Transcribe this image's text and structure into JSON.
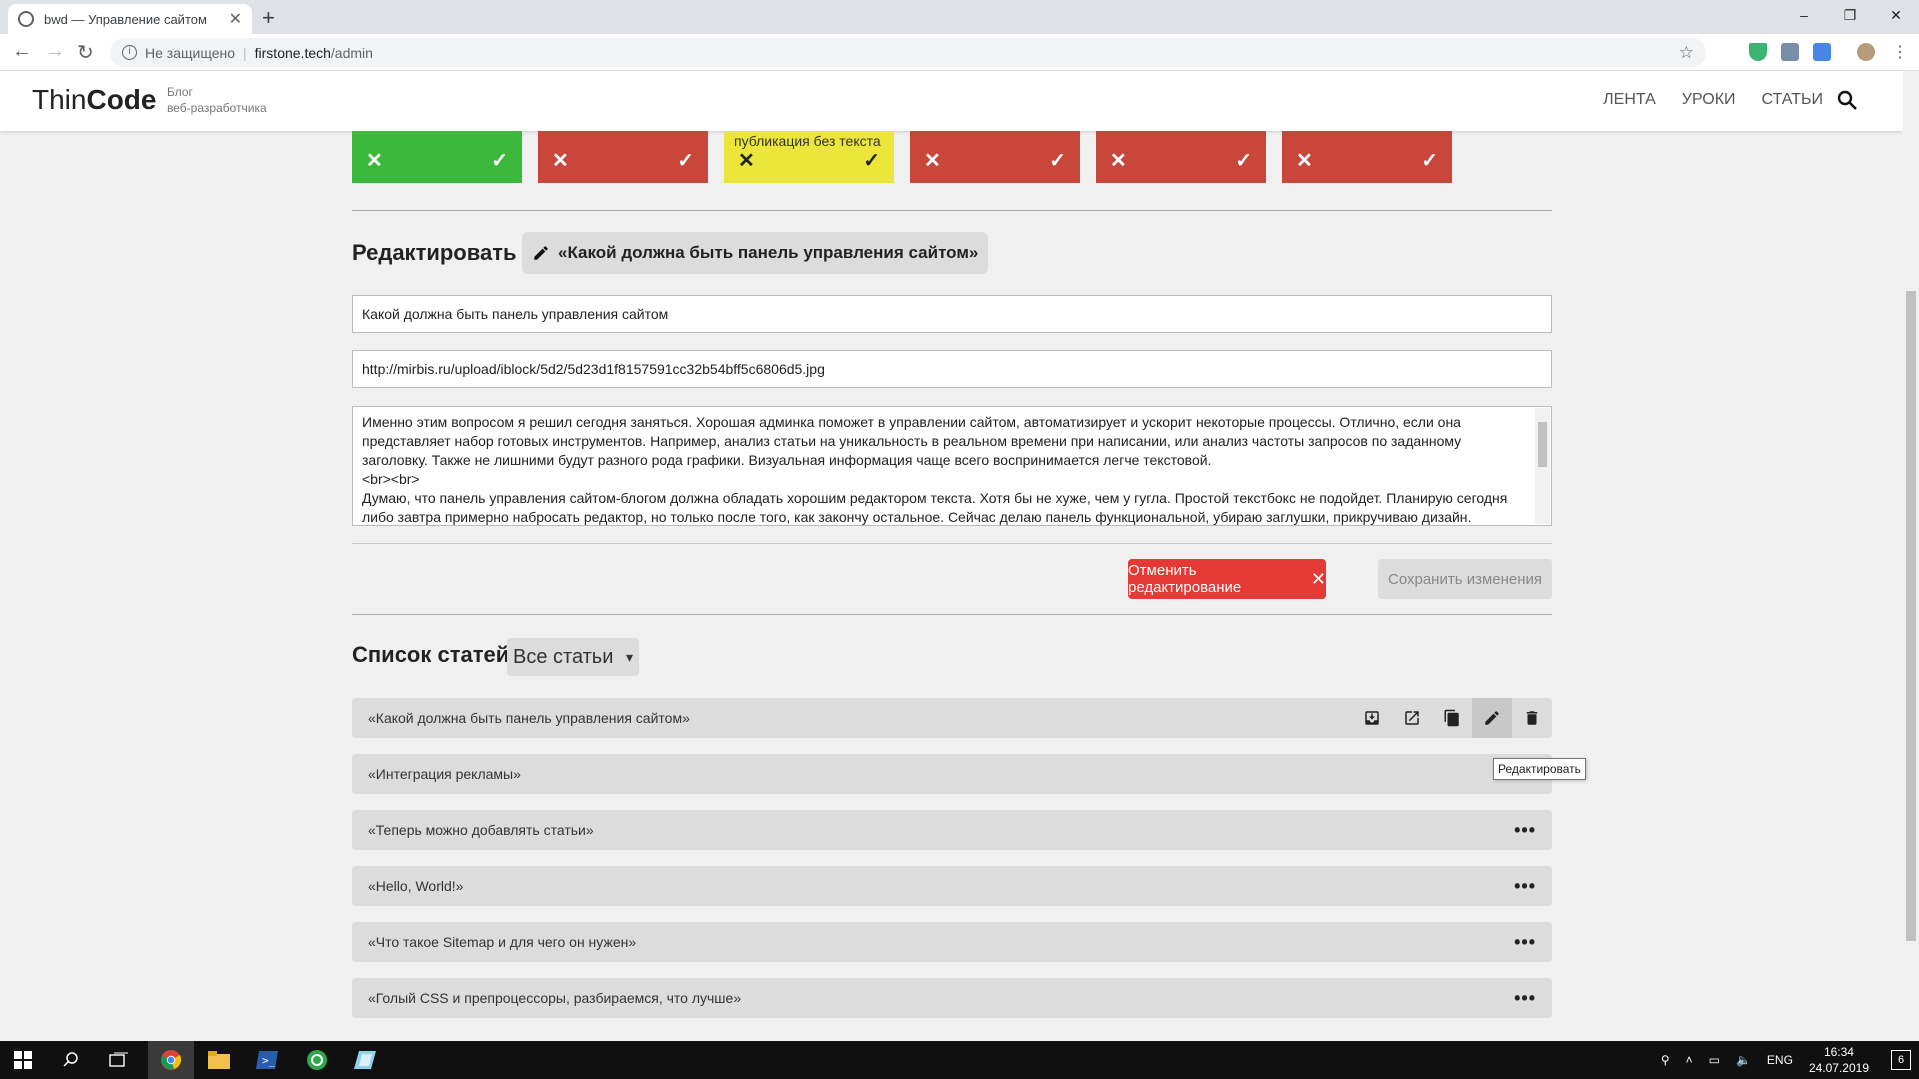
{
  "browser": {
    "tab_title": "bwd — Управление сайтом",
    "tab_close": "✕",
    "new_tab": "+",
    "security_label": "Не защищено",
    "url_host": "firstone.tech",
    "url_path": "/admin",
    "window_controls": [
      "–",
      "❐",
      "✕"
    ]
  },
  "site": {
    "logo_thin": "Thin",
    "logo_code": "Code",
    "tagline_line1": "Блог",
    "tagline_line2": "веб-разработчика",
    "nav": [
      "ЛЕНТА",
      "УРОКИ",
      "СТАТЬИ"
    ]
  },
  "status_blocks": [
    {
      "color": "#3cb93c",
      "note": ""
    },
    {
      "color": "#c9473a",
      "note": ""
    },
    {
      "color": "#ece53a",
      "note": "публикация без текста"
    },
    {
      "color": "#c9473a",
      "note": ""
    },
    {
      "color": "#c9473a",
      "note": ""
    },
    {
      "color": "#c9473a",
      "note": ""
    }
  ],
  "status_symbols": {
    "reject": "✕",
    "approve": "✓"
  },
  "edit": {
    "heading": "Редактировать",
    "chip_label": "«Какой должна быть панель управления сайтом»",
    "title_value": "Какой должна быть панель управления сайтом",
    "image_value": "http://mirbis.ru/upload/iblock/5d2/5d23d1f8157591cc32b54bff5c6806d5.jpg",
    "body_text": "Именно этим вопросом я решил сегодня заняться. Хорошая админка поможет в управлении сайтом, автоматизирует и ускорит некоторые процессы. Отлично, если она представляет набор готовых инструментов. Например, анализ статьи на уникальность в реальном времени при написании, или анализ частоты запросов по заданному заголовку. Также не лишними будут разного рода графики. Визуальная информация чаще всего воспринимается легче текстовой.\n<br><br>\nДумаю, что панель управления сайтом-блогом должна обладать хорошим редактором текста. Хотя бы не хуже, чем у гугла. Простой текстбокс не подойдет. Планирую сегодня либо завтра примерно набросать редактор, но только после того, как закончу остальное. Сейчас делаю панель функциональной, убираю заглушки, прикручиваю дизайн. Удаление",
    "cancel_label": "Отменить редактирование",
    "cancel_icon": "✕",
    "save_label": "Сохранить изменения"
  },
  "list": {
    "heading": "Список статей",
    "filter_value": "Все статьи",
    "more_glyph": "•••",
    "tooltip": "Редактировать",
    "articles": [
      "«Какой должна быть панель управления сайтом»",
      "«Интеграция рекламы»",
      "«Теперь можно добавлять статьи»",
      "«Hello, World!»",
      "«Что такое Sitemap и для чего он нужен»",
      "«Голый CSS и препроцессоры, разбираемся, что лучше»"
    ]
  },
  "taskbar": {
    "language": "ENG",
    "time": "16:34",
    "date": "24.07.2019",
    "notifications": "6"
  }
}
